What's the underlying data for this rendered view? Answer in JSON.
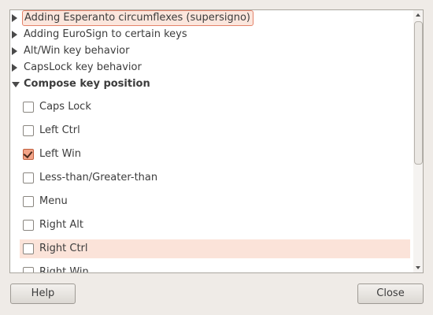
{
  "tree": {
    "items": [
      {
        "label": "Adding Esperanto circumflexes (supersigno)",
        "expanded": false,
        "selected": true
      },
      {
        "label": "Adding EuroSign to certain keys",
        "expanded": false
      },
      {
        "label": "Alt/Win key behavior",
        "expanded": false
      },
      {
        "label": "CapsLock key behavior",
        "expanded": false
      },
      {
        "label": "Compose key position",
        "expanded": true
      }
    ],
    "compose_options": [
      {
        "label": "Caps Lock",
        "checked": false
      },
      {
        "label": "Left Ctrl",
        "checked": false
      },
      {
        "label": "Left Win",
        "checked": true
      },
      {
        "label": "Less-than/Greater-than",
        "checked": false
      },
      {
        "label": "Menu",
        "checked": false
      },
      {
        "label": "Right Alt",
        "checked": false
      },
      {
        "label": "Right Ctrl",
        "checked": false,
        "hovered": true
      },
      {
        "label": "Right Win",
        "checked": false
      }
    ]
  },
  "buttons": {
    "help": "Help",
    "close": "Close"
  },
  "colors": {
    "selection_border": "#e4836a",
    "selection_fill": "#fbe6dd",
    "hover_fill": "#fbe3d9",
    "checked_fill": "#f3a488"
  }
}
